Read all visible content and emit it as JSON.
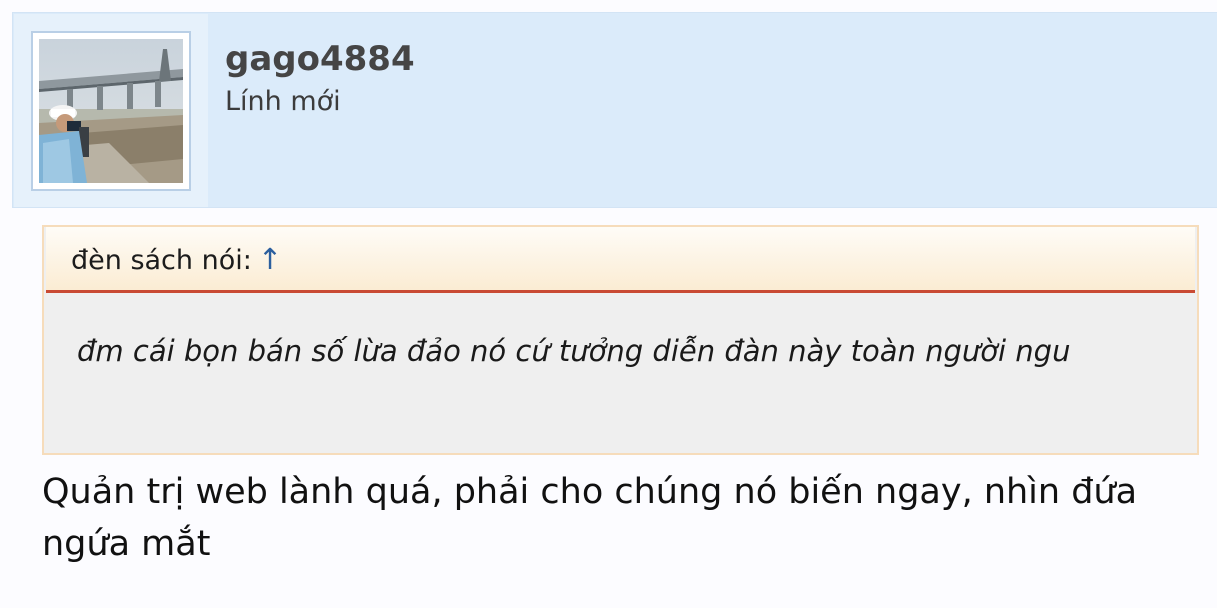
{
  "user": {
    "name": "gago4884",
    "rank": "Lính mới",
    "avatar_icon": "avatar-photo-surveyor-bridge"
  },
  "quote": {
    "author_label": "đèn sách nói:",
    "link_glyph": "↑",
    "text": "đm cái bọn bán số lừa đảo nó cứ tưởng diễn đàn này toàn người ngu"
  },
  "post": {
    "message": "Quản trị web lành quá, phải cho chúng nó biến ngay, nhìn đứa ngứa mắt"
  },
  "colors": {
    "user_bar_bg": "#dbebfa",
    "quote_border": "#f6dcbb",
    "quote_rule": "#c94a33",
    "link": "#2b5f9e"
  }
}
